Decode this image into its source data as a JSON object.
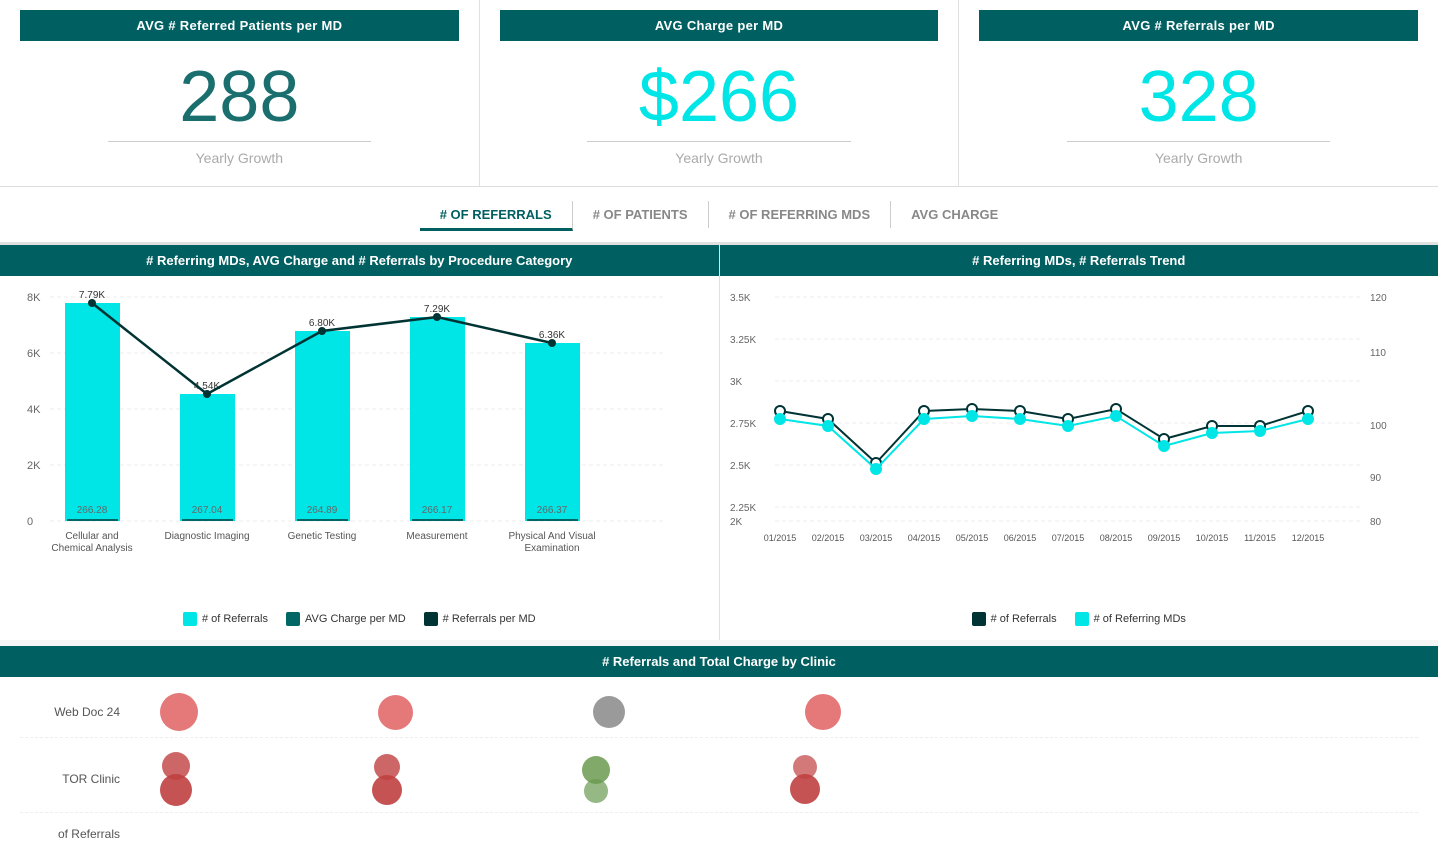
{
  "kpi": {
    "cards": [
      {
        "header": "AVG # Referred Patients per MD",
        "value": "288",
        "value_class": "",
        "label": "Yearly Growth"
      },
      {
        "header": "AVG Charge per MD",
        "value": "$266",
        "value_class": "cyan",
        "label": "Yearly Growth"
      },
      {
        "header": "AVG # Referrals per MD",
        "value": "328",
        "value_class": "cyan",
        "label": "Yearly Growth"
      }
    ]
  },
  "tabs": [
    {
      "label": "# OF REFERRALS",
      "active": true
    },
    {
      "label": "# OF PATIENTS",
      "active": false
    },
    {
      "label": "# OF REFERRING MDS",
      "active": false
    },
    {
      "label": "AVG CHARGE",
      "active": false
    }
  ],
  "bar_chart": {
    "title": "# Referring MDs, AVG Charge and # Referrals by Procedure Category",
    "y_left_max": "8K",
    "y_left_ticks": [
      "8K",
      "6K",
      "4K",
      "2K",
      "0"
    ],
    "categories": [
      {
        "name": "Cellular and\nChemical Analysis",
        "referrals": 7790,
        "avg_charge": 266.28,
        "referrals_per_md": 7790
      },
      {
        "name": "Diagnostic Imaging",
        "referrals": 4540,
        "avg_charge": 267.04,
        "referrals_per_md": 4540
      },
      {
        "name": "Genetic Testing",
        "referrals": 6800,
        "avg_charge": 264.89,
        "referrals_per_md": 6800
      },
      {
        "name": "Measurement",
        "referrals": 7290,
        "avg_charge": 266.17,
        "referrals_per_md": 7290
      },
      {
        "name": "Physical And Visual\nExamination",
        "referrals": 6360,
        "avg_charge": 266.37,
        "referrals_per_md": 6360
      }
    ],
    "labels": {
      "referrals": [
        "7.79K",
        "4.54K",
        "6.80K",
        "7.29K",
        "6.36K"
      ],
      "avg_charge": [
        "266.28",
        "267.04",
        "264.89",
        "266.17",
        "266.37"
      ]
    },
    "legend": [
      {
        "color": "#00e5e5",
        "label": "# of Referrals"
      },
      {
        "color": "#006666",
        "label": "AVG Charge per MD"
      },
      {
        "color": "#003333",
        "label": "# Referrals per MD"
      }
    ]
  },
  "trend_chart": {
    "title": "# Referring MDs, # Referrals Trend",
    "months": [
      "01/2015",
      "02/2015",
      "03/2015",
      "04/2015",
      "05/2015",
      "06/2015",
      "07/2015",
      "08/2015",
      "09/2015",
      "10/2015",
      "11/2015",
      "12/2015"
    ],
    "y_left_ticks": [
      "3.5K",
      "3.25K",
      "3K",
      "2.75K",
      "2.5K",
      "2.25K",
      "2K"
    ],
    "y_right_ticks": [
      "120",
      "110",
      "100",
      "90",
      "80"
    ],
    "legend": [
      {
        "color": "#003333",
        "label": "# of Referrals"
      },
      {
        "color": "#00e5e5",
        "label": "# of Referring MDs"
      }
    ]
  },
  "bottom_chart": {
    "title": "# Referrals and Total Charge by Clinic",
    "clinics": [
      {
        "name": "Web Doc 24"
      },
      {
        "name": "TOR Clinic"
      },
      {
        "name": "Referrals"
      }
    ]
  },
  "colors": {
    "header_bg": "#005f60",
    "cyan_accent": "#00e5e5",
    "dark_teal": "#1a6e6e",
    "text_gray": "#888888"
  }
}
